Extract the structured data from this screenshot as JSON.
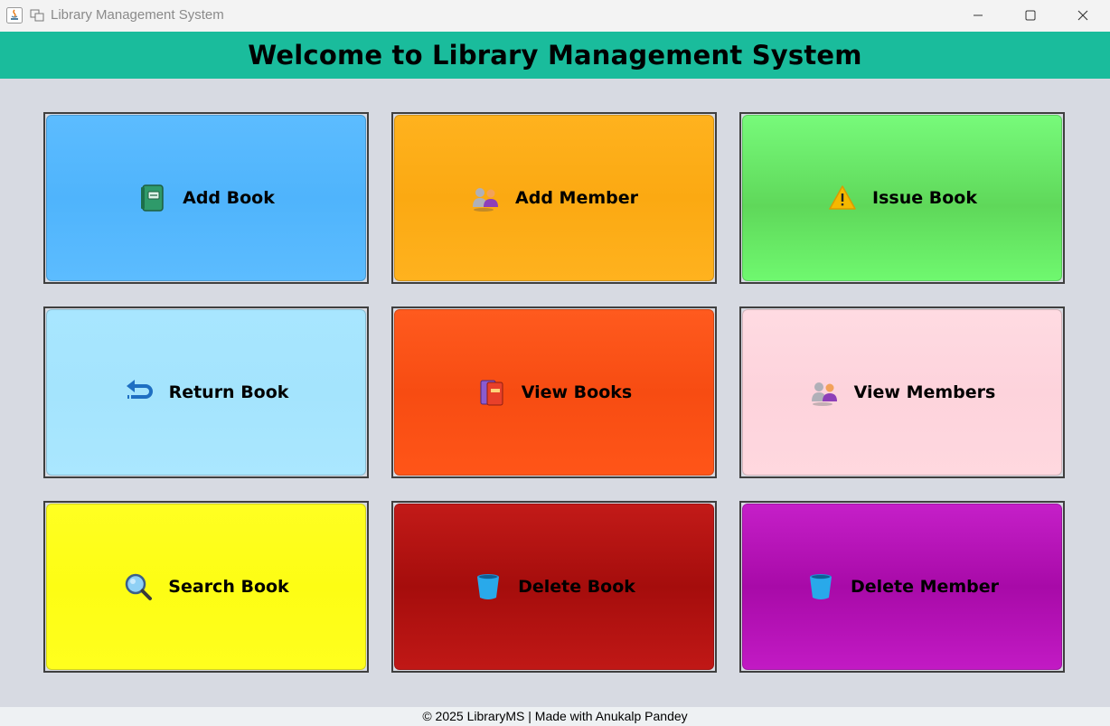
{
  "window": {
    "title": "Library Management System"
  },
  "header": {
    "title": "Welcome to Library Management System",
    "background": "#1abc9c"
  },
  "tiles": [
    {
      "label": "Add Book",
      "icon": "green-book-icon",
      "color": "#55b8fe"
    },
    {
      "label": "Add Member",
      "icon": "add-member-icon",
      "color": "#ffad18"
    },
    {
      "label": "Issue Book",
      "icon": "warning-icon",
      "color": "#6ef06e"
    },
    {
      "label": "Return Book",
      "icon": "return-arrow-icon",
      "color": "#a6e5fe"
    },
    {
      "label": "View Books",
      "icon": "books-icon",
      "color": "#fb5218"
    },
    {
      "label": "View Members",
      "icon": "members-icon",
      "color": "#fed6de"
    },
    {
      "label": "Search Book",
      "icon": "magnifier-icon",
      "color": "#ffff1a"
    },
    {
      "label": "Delete Book",
      "icon": "trash-bucket-icon",
      "color": "#b81412"
    },
    {
      "label": "Delete Member",
      "icon": "trash-bucket-icon",
      "color": "#b815ba"
    }
  ],
  "footer": {
    "text": "© 2025 LibraryMS | Made with Anukalp Pandey"
  }
}
